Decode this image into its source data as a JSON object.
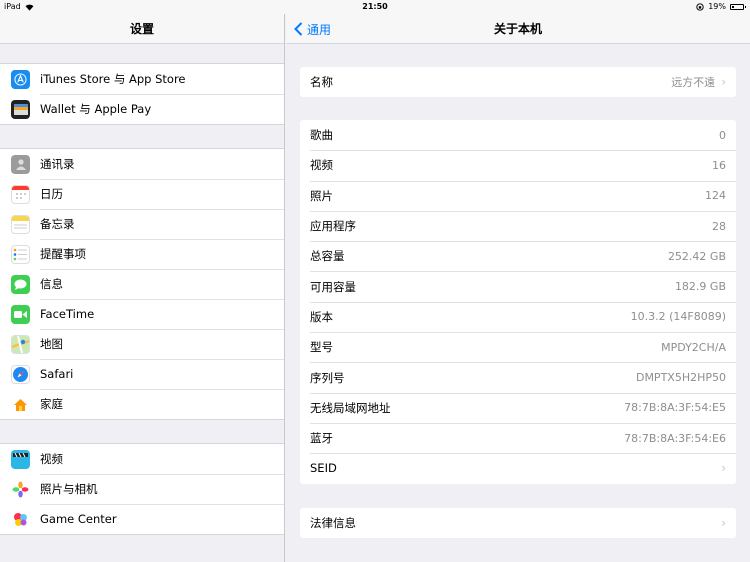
{
  "status_bar": {
    "device": "iPad",
    "time": "21:50",
    "battery_percent": "19%",
    "battery_level": 0.19
  },
  "master": {
    "title": "设置",
    "groups": [
      [
        {
          "label": "iTunes Store 与 App Store",
          "icon": "app-store-icon",
          "color": "#1a8cf0"
        },
        {
          "label": "Wallet 与 Apple Pay",
          "icon": "wallet-icon",
          "color": "#222222"
        }
      ],
      [
        {
          "label": "通讯录",
          "icon": "contacts-icon",
          "color": "#9b9b9b"
        },
        {
          "label": "日历",
          "icon": "calendar-icon",
          "color": "#ffffff"
        },
        {
          "label": "备忘录",
          "icon": "notes-icon",
          "color": "#f8d54a"
        },
        {
          "label": "提醒事项",
          "icon": "reminders-icon",
          "color": "#ffffff"
        },
        {
          "label": "信息",
          "icon": "messages-icon",
          "color": "#3ecf52"
        },
        {
          "label": "FaceTime",
          "icon": "facetime-icon",
          "color": "#3ecf52"
        },
        {
          "label": "地图",
          "icon": "maps-icon",
          "color": "#6cc4e8"
        },
        {
          "label": "Safari",
          "icon": "safari-icon",
          "color": "#1d89f2"
        },
        {
          "label": "家庭",
          "icon": "home-icon",
          "color": "#ffffff"
        }
      ],
      [
        {
          "label": "视频",
          "icon": "videos-icon",
          "color": "#2ab7e8"
        },
        {
          "label": "照片与相机",
          "icon": "photos-icon",
          "color": "#ffffff"
        },
        {
          "label": "Game Center",
          "icon": "game-center-icon",
          "color": "#ffffff"
        }
      ]
    ]
  },
  "detail": {
    "back_label": "通用",
    "title": "关于本机",
    "name_row": {
      "label": "名称",
      "value": "远方不遠"
    },
    "info_rows": [
      {
        "label": "歌曲",
        "value": "0"
      },
      {
        "label": "视频",
        "value": "16"
      },
      {
        "label": "照片",
        "value": "124"
      },
      {
        "label": "应用程序",
        "value": "28"
      },
      {
        "label": "总容量",
        "value": "252.42 GB"
      },
      {
        "label": "可用容量",
        "value": "182.9 GB"
      },
      {
        "label": "版本",
        "value": "10.3.2 (14F8089)"
      },
      {
        "label": "型号",
        "value": "MPDY2CH/A"
      },
      {
        "label": "序列号",
        "value": "DMPTX5H2HP50"
      },
      {
        "label": "无线局域网地址",
        "value": "78:7B:8A:3F:54:E5"
      },
      {
        "label": "蓝牙",
        "value": "78:7B:8A:3F:54:E6"
      },
      {
        "label": "SEID",
        "value": ""
      }
    ],
    "legal_row": {
      "label": "法律信息"
    }
  }
}
